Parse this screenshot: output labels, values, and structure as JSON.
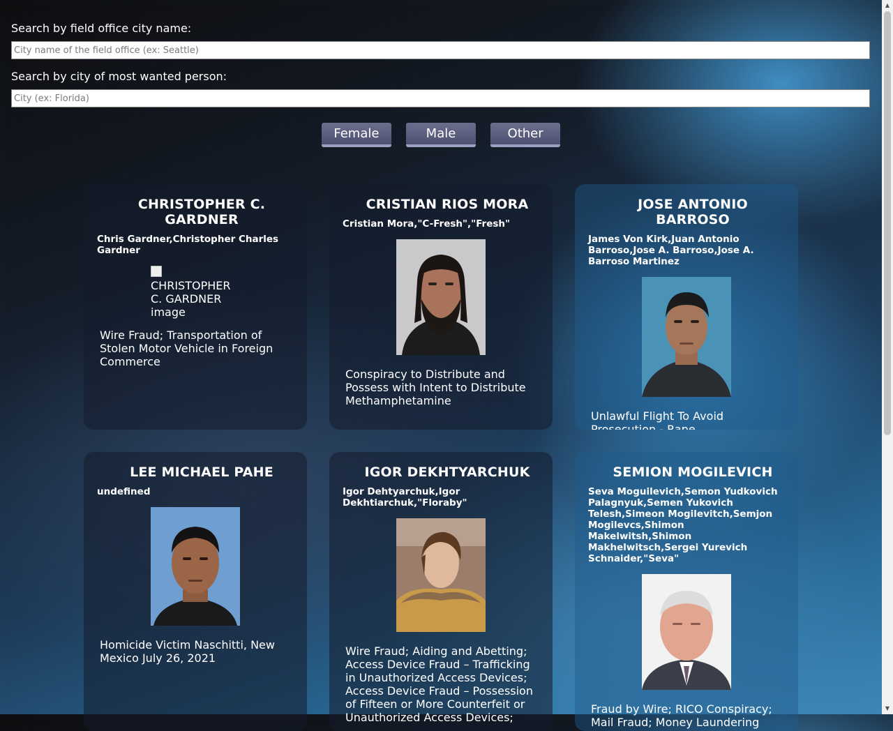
{
  "search": {
    "field_office_label": "Search by field office city name:",
    "field_office_placeholder": "City name of the field office (ex: Seattle)",
    "wanted_city_label": "Search by city of most wanted person:",
    "wanted_city_placeholder": "City (ex: Florida)"
  },
  "filters": {
    "female": "Female",
    "male": "Male",
    "other": "Other"
  },
  "cards": [
    {
      "name": "CHRISTOPHER C. GARDNER",
      "aliases": "Chris Gardner,Christopher Charles Gardner",
      "image_alt": "CHRISTOPHER C. GARDNER image",
      "subjects": "Wire Fraud; Transportation of Stolen Motor Vehicle in Foreign Commerce"
    },
    {
      "name": "CRISTIAN RIOS MORA",
      "aliases": "Cristian Mora,\"C-Fresh\",\"Fresh\"",
      "image_alt": "CRISTIAN RIOS MORA image",
      "subjects": "Conspiracy to Distribute and Possess with Intent to Distribute Methamphetamine"
    },
    {
      "name": "JOSE ANTONIO BARROSO",
      "aliases": "James Von Kirk,Juan Antonio Barroso,Jose A. Barroso,Jose A. Barroso Martinez",
      "image_alt": "JOSE ANTONIO BARROSO image",
      "subjects": "Unlawful Flight To Avoid Prosecution - Rape"
    },
    {
      "name": "LEE MICHAEL PAHE",
      "aliases": "undefined",
      "image_alt": "LEE MICHAEL PAHE image",
      "subjects": "Homicide Victim Naschitti, New Mexico July 26, 2021"
    },
    {
      "name": "IGOR DEKHTYARCHUK",
      "aliases": "Igor Dehtyarchuk,Igor Dekhtiarchuk,\"Floraby\"",
      "image_alt": "IGOR DEKHTYARCHUK image",
      "subjects": "Wire Fraud; Aiding and Abetting; Access Device Fraud – Trafficking in Unauthorized Access Devices; Access Device Fraud – Possession of Fifteen or More Counterfeit or Unauthorized Access Devices;"
    },
    {
      "name": "SEMION MOGILEVICH",
      "aliases": "Seva Moguilevich,Semon Yudkovich Palagnyuk,Semen Yukovich Telesh,Simeon Mogilevitch,Semjon Mogilevcs,Shimon Makelwitsh,Shimon Makhelwitsch,Sergei Yurevich Schnaider,\"Seva\"",
      "image_alt": "SEMION MOGILEVICH image",
      "subjects": "Fraud by Wire; RICO Conspiracy; Mail Fraud; Money Laundering Conspiracy;"
    }
  ]
}
